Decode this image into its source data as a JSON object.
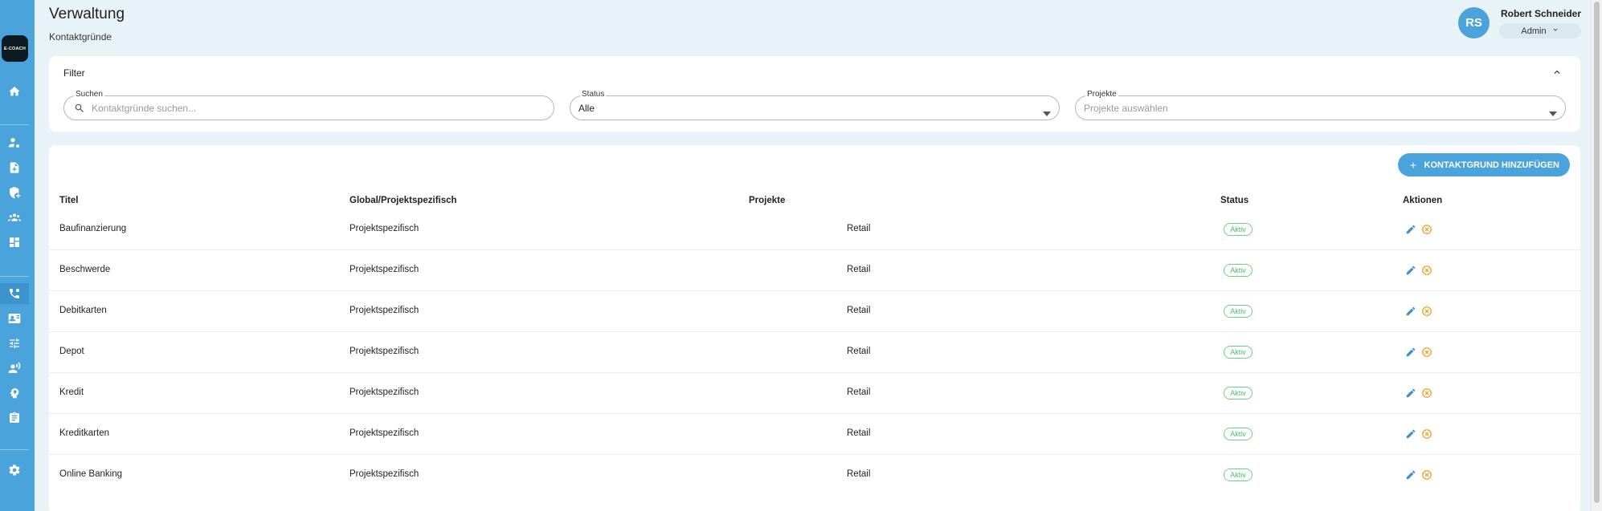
{
  "app": {
    "logo_text": "E-COACH"
  },
  "sidebar": {
    "items": [
      {
        "icon": "home-icon"
      },
      {
        "icon": "person-settings-icon"
      },
      {
        "icon": "document-add-icon"
      },
      {
        "icon": "shield-add-icon"
      },
      {
        "icon": "group-icon"
      },
      {
        "icon": "dashboard-icon"
      },
      {
        "icon": "phone-settings-icon",
        "active": true
      },
      {
        "icon": "contact-card-icon"
      },
      {
        "icon": "sliders-icon"
      },
      {
        "icon": "speaker-person-icon"
      },
      {
        "icon": "head-idea-icon"
      },
      {
        "icon": "clipboard-icon"
      },
      {
        "icon": "gear-icon"
      }
    ]
  },
  "header": {
    "title": "Verwaltung",
    "subtitle": "Kontaktgründe",
    "user": {
      "initials": "RS",
      "name": "Robert Schneider",
      "role": "Admin"
    }
  },
  "filter": {
    "title": "Filter",
    "search": {
      "label": "Suchen",
      "placeholder": "Kontaktgründe suchen..."
    },
    "status": {
      "label": "Status",
      "value": "Alle"
    },
    "projects": {
      "label": "Projekte",
      "placeholder": "Projekte auswählen"
    }
  },
  "table": {
    "add_button": "KONTAKTGRUND HINZUFÜGEN",
    "columns": [
      "Titel",
      "Global/Projektspezifisch",
      "Projekte",
      "Status",
      "Aktionen"
    ],
    "rows": [
      {
        "title": "Baufinanzierung",
        "scope": "Projektspezifisch",
        "projects": "Retail",
        "status": "Aktiv"
      },
      {
        "title": "Beschwerde",
        "scope": "Projektspezifisch",
        "projects": "Retail",
        "status": "Aktiv"
      },
      {
        "title": "Debitkarten",
        "scope": "Projektspezifisch",
        "projects": "Retail",
        "status": "Aktiv"
      },
      {
        "title": "Depot",
        "scope": "Projektspezifisch",
        "projects": "Retail",
        "status": "Aktiv"
      },
      {
        "title": "Kredit",
        "scope": "Projektspezifisch",
        "projects": "Retail",
        "status": "Aktiv"
      },
      {
        "title": "Kreditkarten",
        "scope": "Projektspezifisch",
        "projects": "Retail",
        "status": "Aktiv"
      },
      {
        "title": "Online Banking",
        "scope": "Projektspezifisch",
        "projects": "Retail",
        "status": "Aktiv"
      }
    ]
  },
  "colors": {
    "primary": "#4ba3dc",
    "background": "#e8f3f8",
    "active_badge": "#4cbb6d",
    "delete": "#f0a020"
  }
}
